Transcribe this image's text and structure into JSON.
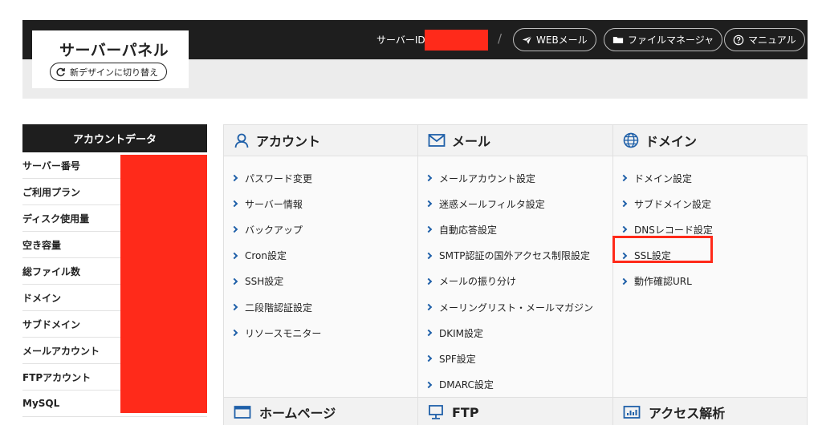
{
  "header": {
    "panel_title": "サーバーパネル",
    "switch_label": "新デザインに切り替え",
    "server_id_label": "サーバーID",
    "separator": "/",
    "links": [
      {
        "label": "WEBメール",
        "icon": "paper-plane-icon"
      },
      {
        "label": "ファイルマネージャ",
        "icon": "folder-icon"
      },
      {
        "label": "マニュアル",
        "icon": "help-circle-icon"
      }
    ],
    "redaction_color": "#ff2a1a"
  },
  "account_data": {
    "title": "アカウントデータ",
    "rows": [
      "サーバー番号",
      "ご利用プラン",
      "ディスク使用量",
      "空き容量",
      "総ファイル数",
      "ドメイン",
      "サブドメイン",
      "メールアカウント",
      "FTPアカウント",
      "MySQL"
    ]
  },
  "menu": {
    "account": {
      "title": "アカウント",
      "icon": "user-icon",
      "items": [
        "パスワード変更",
        "サーバー情報",
        "バックアップ",
        "Cron設定",
        "SSH設定",
        "二段階認証設定",
        "リソースモニター"
      ]
    },
    "mail": {
      "title": "メール",
      "icon": "envelope-icon",
      "items": [
        "メールアカウント設定",
        "迷惑メールフィルタ設定",
        "自動応答設定",
        "SMTP認証の国外アクセス制限設定",
        "メールの振り分け",
        "メーリングリスト・メールマガジン",
        "DKIM設定",
        "SPF設定",
        "DMARC設定"
      ]
    },
    "domain": {
      "title": "ドメイン",
      "icon": "globe-icon",
      "items": [
        "ドメイン設定",
        "サブドメイン設定",
        "DNSレコード設定",
        "SSL設定",
        "動作確認URL"
      ]
    },
    "homepage": {
      "title": "ホームページ",
      "icon": "browser-window-icon"
    },
    "ftp": {
      "title": "FTP",
      "icon": "monitor-icon"
    },
    "access": {
      "title": "アクセス解析",
      "icon": "bar-chart-icon"
    }
  },
  "colors": {
    "accent_chevron": "#1e5fa8",
    "icon_blue": "#1e5fa8",
    "highlight": "#ff2a1a"
  }
}
